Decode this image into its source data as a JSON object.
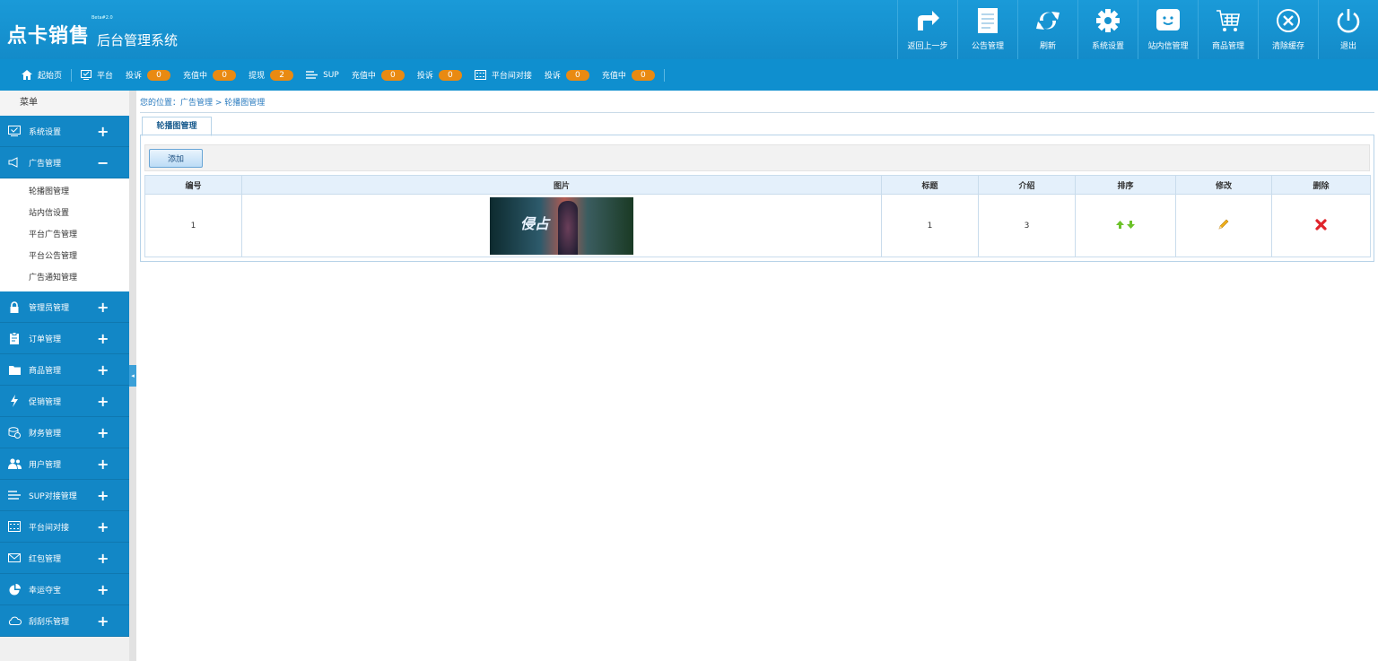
{
  "header": {
    "logo_main": "点卡销售",
    "logo_version": "Beta#2.0",
    "logo_sub": "后台管理系统",
    "buttons": [
      {
        "label": "返回上一步",
        "icon": "return-arrow-icon"
      },
      {
        "label": "公告管理",
        "icon": "document-icon"
      },
      {
        "label": "刷新",
        "icon": "refresh-icon"
      },
      {
        "label": "系统设置",
        "icon": "gear-icon"
      },
      {
        "label": "站内信管理",
        "icon": "message-smile-icon"
      },
      {
        "label": "商品管理",
        "icon": "cart-icon"
      },
      {
        "label": "清除缓存",
        "icon": "clear-circle-icon"
      },
      {
        "label": "退出",
        "icon": "power-icon"
      }
    ]
  },
  "subnav": {
    "home": "起始页",
    "platform": "平台",
    "complaint1": "投诉",
    "complaint1_count": "0",
    "recharging1": "充值中",
    "recharging1_count": "0",
    "withdraw": "提现",
    "withdraw_count": "2",
    "sup": "SUP",
    "recharging2": "充值中",
    "recharging2_count": "0",
    "complaint2": "投诉",
    "complaint2_count": "0",
    "inter": "平台间对接",
    "complaint3": "投诉",
    "complaint3_count": "0",
    "recharging3": "充值中",
    "recharging3_count": "0"
  },
  "sidebar": {
    "title": "菜单",
    "items": [
      {
        "label": "系统设置",
        "icon": "monitor-check-icon",
        "toggle": "+"
      },
      {
        "label": "广告管理",
        "icon": "megaphone-icon",
        "toggle": "−"
      },
      {
        "label": "管理员管理",
        "icon": "lock-icon",
        "toggle": "+"
      },
      {
        "label": "订单管理",
        "icon": "clipboard-icon",
        "toggle": "+"
      },
      {
        "label": "商品管理",
        "icon": "folder-icon",
        "toggle": "+"
      },
      {
        "label": "促销管理",
        "icon": "lightning-icon",
        "toggle": "+"
      },
      {
        "label": "财务管理",
        "icon": "coins-icon",
        "toggle": "+"
      },
      {
        "label": "用户管理",
        "icon": "users-icon",
        "toggle": "+"
      },
      {
        "label": "SUP对接管理",
        "icon": "lines-icon",
        "toggle": "+"
      },
      {
        "label": "平台间对接",
        "icon": "grid-icon",
        "toggle": "+"
      },
      {
        "label": "红包管理",
        "icon": "envelope-icon",
        "toggle": "+"
      },
      {
        "label": "幸运夺宝",
        "icon": "pie-icon",
        "toggle": "+"
      },
      {
        "label": "刮刮乐管理",
        "icon": "cloud-icon",
        "toggle": "+"
      }
    ],
    "subitems": [
      "轮播图管理",
      "站内信设置",
      "平台广告管理",
      "平台公告管理",
      "广告通知管理"
    ]
  },
  "breadcrumb": "您的位置：广告管理 > 轮播图管理",
  "tab": "轮播图管理",
  "toolbar": {
    "add_label": "添加"
  },
  "table": {
    "headers": [
      "编号",
      "图片",
      "标题",
      "介绍",
      "排序",
      "修改",
      "删除"
    ],
    "rows": [
      {
        "id": "1",
        "banner_text": "侵占",
        "title": "1",
        "intro": "3"
      }
    ]
  }
}
